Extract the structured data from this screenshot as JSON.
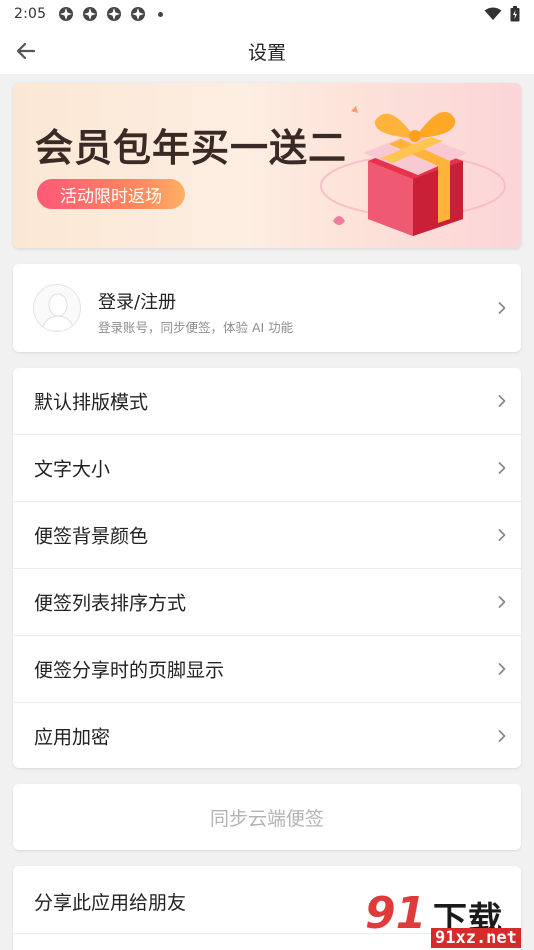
{
  "status_bar": {
    "time": "2:05",
    "notification_icons": [
      "app-icon",
      "app-icon",
      "app-icon",
      "app-icon"
    ],
    "indicators": [
      "wifi-icon",
      "battery-icon"
    ]
  },
  "app_bar": {
    "title": "设置",
    "back_icon": "arrow-left-icon"
  },
  "banner": {
    "headline": "会员包年买一送二",
    "cta": "活动限时返场",
    "colors": {
      "cta_start": "#ff5877",
      "cta_end": "#ffb066",
      "gift": "#e8314a"
    }
  },
  "login": {
    "title": "登录/注册",
    "subtitle": "登录账号，同步便签，体验 AI 功能"
  },
  "menu": {
    "items": [
      {
        "label": "默认排版模式"
      },
      {
        "label": "文字大小"
      },
      {
        "label": "便签背景颜色"
      },
      {
        "label": "便签列表排序方式"
      },
      {
        "label": "便签分享时的页脚显示"
      },
      {
        "label": "应用加密"
      }
    ]
  },
  "sync": {
    "label": "同步云端便签"
  },
  "share": {
    "label": "分享此应用给朋友"
  },
  "watermark": {
    "number": "91",
    "brand": "下载站",
    "url": "91xz.net"
  }
}
